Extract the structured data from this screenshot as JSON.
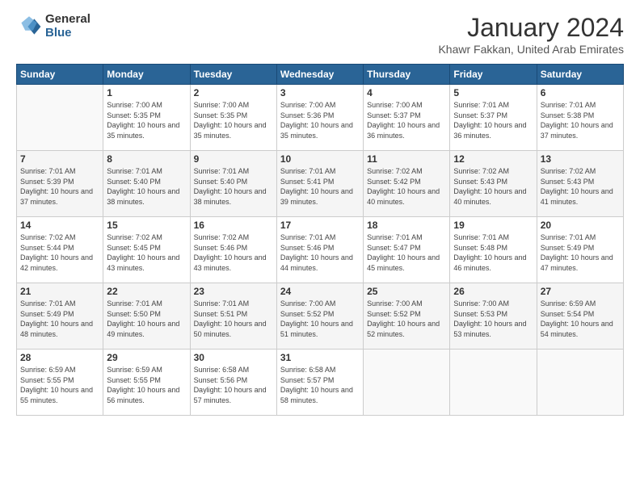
{
  "header": {
    "logo_general": "General",
    "logo_blue": "Blue",
    "title": "January 2024",
    "subtitle": "Khawr Fakkan, United Arab Emirates"
  },
  "weekdays": [
    "Sunday",
    "Monday",
    "Tuesday",
    "Wednesday",
    "Thursday",
    "Friday",
    "Saturday"
  ],
  "weeks": [
    [
      {
        "day": "",
        "empty": true
      },
      {
        "day": "1",
        "sunrise": "7:00 AM",
        "sunset": "5:35 PM",
        "daylight": "10 hours and 35 minutes."
      },
      {
        "day": "2",
        "sunrise": "7:00 AM",
        "sunset": "5:35 PM",
        "daylight": "10 hours and 35 minutes."
      },
      {
        "day": "3",
        "sunrise": "7:00 AM",
        "sunset": "5:36 PM",
        "daylight": "10 hours and 35 minutes."
      },
      {
        "day": "4",
        "sunrise": "7:00 AM",
        "sunset": "5:37 PM",
        "daylight": "10 hours and 36 minutes."
      },
      {
        "day": "5",
        "sunrise": "7:01 AM",
        "sunset": "5:37 PM",
        "daylight": "10 hours and 36 minutes."
      },
      {
        "day": "6",
        "sunrise": "7:01 AM",
        "sunset": "5:38 PM",
        "daylight": "10 hours and 37 minutes."
      }
    ],
    [
      {
        "day": "7",
        "sunrise": "7:01 AM",
        "sunset": "5:39 PM",
        "daylight": "10 hours and 37 minutes."
      },
      {
        "day": "8",
        "sunrise": "7:01 AM",
        "sunset": "5:40 PM",
        "daylight": "10 hours and 38 minutes."
      },
      {
        "day": "9",
        "sunrise": "7:01 AM",
        "sunset": "5:40 PM",
        "daylight": "10 hours and 38 minutes."
      },
      {
        "day": "10",
        "sunrise": "7:01 AM",
        "sunset": "5:41 PM",
        "daylight": "10 hours and 39 minutes."
      },
      {
        "day": "11",
        "sunrise": "7:02 AM",
        "sunset": "5:42 PM",
        "daylight": "10 hours and 40 minutes."
      },
      {
        "day": "12",
        "sunrise": "7:02 AM",
        "sunset": "5:43 PM",
        "daylight": "10 hours and 40 minutes."
      },
      {
        "day": "13",
        "sunrise": "7:02 AM",
        "sunset": "5:43 PM",
        "daylight": "10 hours and 41 minutes."
      }
    ],
    [
      {
        "day": "14",
        "sunrise": "7:02 AM",
        "sunset": "5:44 PM",
        "daylight": "10 hours and 42 minutes."
      },
      {
        "day": "15",
        "sunrise": "7:02 AM",
        "sunset": "5:45 PM",
        "daylight": "10 hours and 43 minutes."
      },
      {
        "day": "16",
        "sunrise": "7:02 AM",
        "sunset": "5:46 PM",
        "daylight": "10 hours and 43 minutes."
      },
      {
        "day": "17",
        "sunrise": "7:01 AM",
        "sunset": "5:46 PM",
        "daylight": "10 hours and 44 minutes."
      },
      {
        "day": "18",
        "sunrise": "7:01 AM",
        "sunset": "5:47 PM",
        "daylight": "10 hours and 45 minutes."
      },
      {
        "day": "19",
        "sunrise": "7:01 AM",
        "sunset": "5:48 PM",
        "daylight": "10 hours and 46 minutes."
      },
      {
        "day": "20",
        "sunrise": "7:01 AM",
        "sunset": "5:49 PM",
        "daylight": "10 hours and 47 minutes."
      }
    ],
    [
      {
        "day": "21",
        "sunrise": "7:01 AM",
        "sunset": "5:49 PM",
        "daylight": "10 hours and 48 minutes."
      },
      {
        "day": "22",
        "sunrise": "7:01 AM",
        "sunset": "5:50 PM",
        "daylight": "10 hours and 49 minutes."
      },
      {
        "day": "23",
        "sunrise": "7:01 AM",
        "sunset": "5:51 PM",
        "daylight": "10 hours and 50 minutes."
      },
      {
        "day": "24",
        "sunrise": "7:00 AM",
        "sunset": "5:52 PM",
        "daylight": "10 hours and 51 minutes."
      },
      {
        "day": "25",
        "sunrise": "7:00 AM",
        "sunset": "5:52 PM",
        "daylight": "10 hours and 52 minutes."
      },
      {
        "day": "26",
        "sunrise": "7:00 AM",
        "sunset": "5:53 PM",
        "daylight": "10 hours and 53 minutes."
      },
      {
        "day": "27",
        "sunrise": "6:59 AM",
        "sunset": "5:54 PM",
        "daylight": "10 hours and 54 minutes."
      }
    ],
    [
      {
        "day": "28",
        "sunrise": "6:59 AM",
        "sunset": "5:55 PM",
        "daylight": "10 hours and 55 minutes."
      },
      {
        "day": "29",
        "sunrise": "6:59 AM",
        "sunset": "5:55 PM",
        "daylight": "10 hours and 56 minutes."
      },
      {
        "day": "30",
        "sunrise": "6:58 AM",
        "sunset": "5:56 PM",
        "daylight": "10 hours and 57 minutes."
      },
      {
        "day": "31",
        "sunrise": "6:58 AM",
        "sunset": "5:57 PM",
        "daylight": "10 hours and 58 minutes."
      },
      {
        "day": "",
        "empty": true
      },
      {
        "day": "",
        "empty": true
      },
      {
        "day": "",
        "empty": true
      }
    ]
  ],
  "labels": {
    "sunrise": "Sunrise:",
    "sunset": "Sunset:",
    "daylight": "Daylight:"
  }
}
